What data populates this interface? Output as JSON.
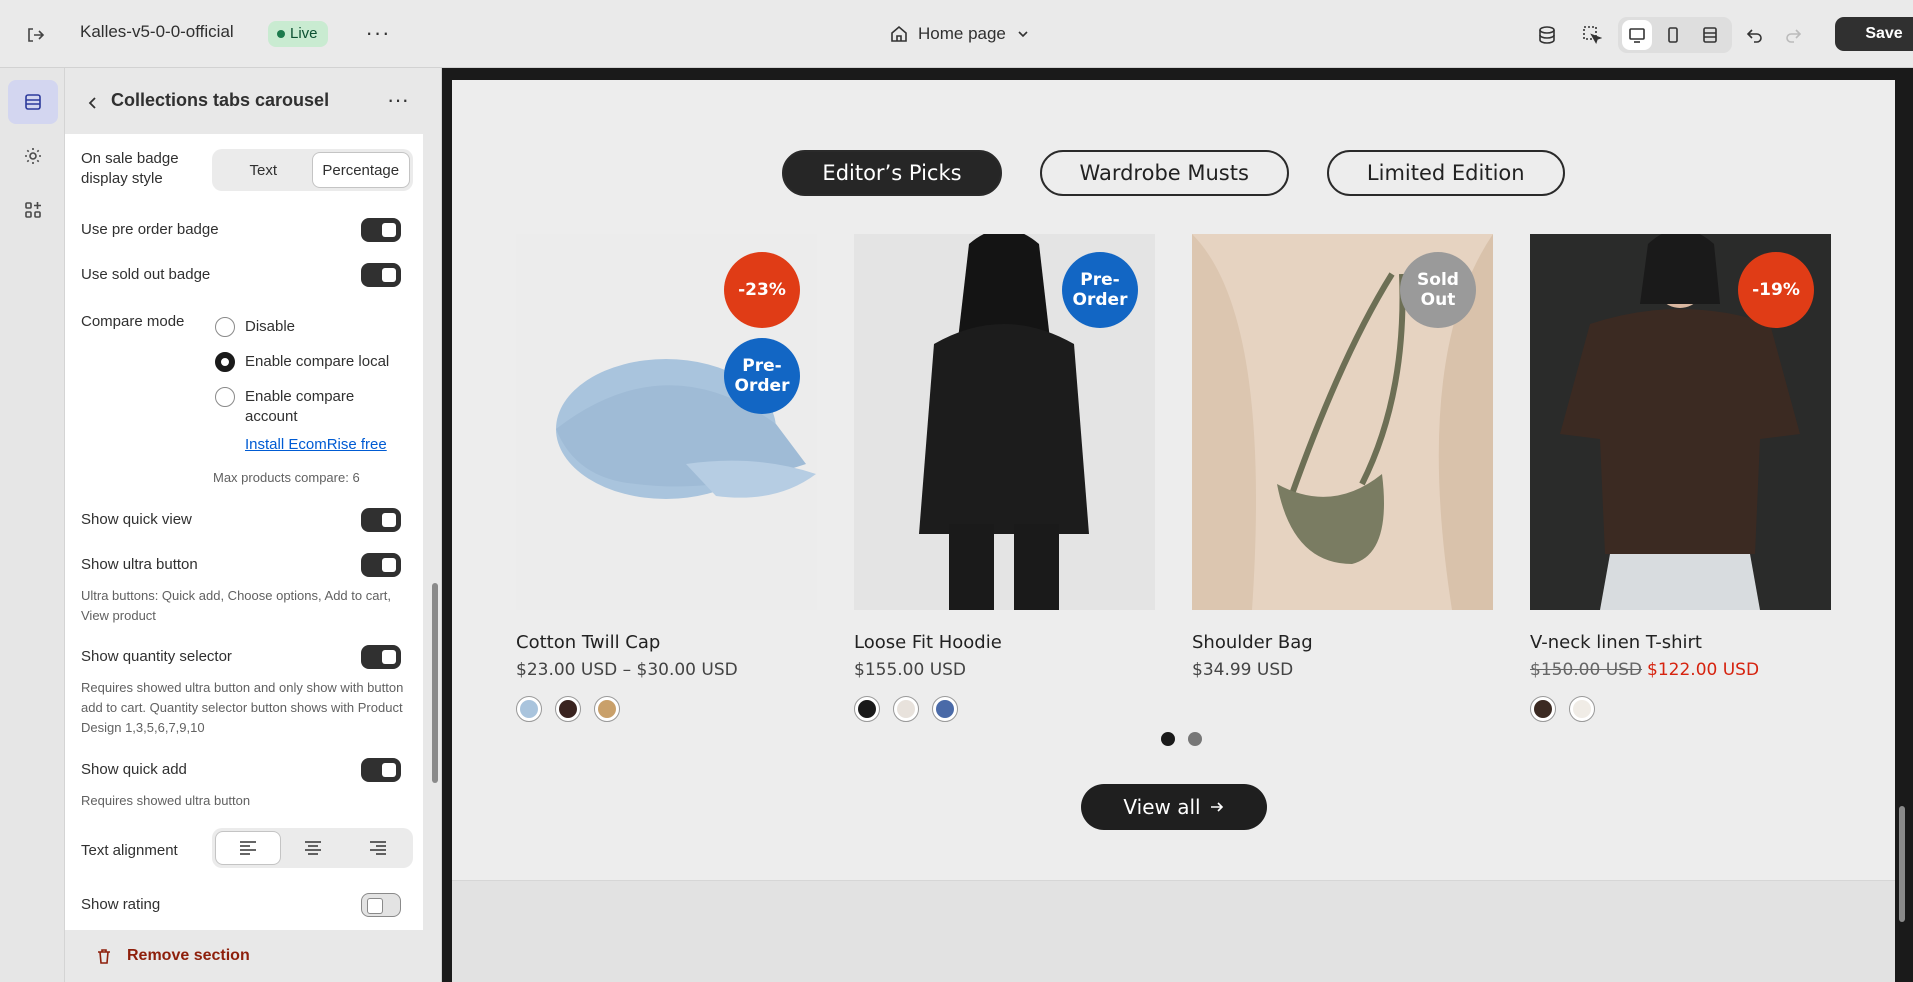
{
  "topbar": {
    "store_name": "Kalles-v5-0-0-official",
    "live_label": "Live",
    "page_selector": "Home page",
    "save_label": "Save"
  },
  "panel": {
    "title": "Collections tabs carousel",
    "settings": {
      "sale_badge_label": "On sale badge display style",
      "sale_badge_options": [
        "Text",
        "Percentage"
      ],
      "sale_badge_selected": "Percentage",
      "pre_order_badge_label": "Use pre order badge",
      "pre_order_badge_on": true,
      "sold_out_badge_label": "Use sold out badge",
      "sold_out_badge_on": true,
      "compare_mode_label": "Compare mode",
      "compare_options": [
        "Disable",
        "Enable compare local",
        "Enable compare account"
      ],
      "compare_selected": "Enable compare local",
      "install_link": "Install EcomRise free",
      "max_compare_help": "Max products compare: 6",
      "quick_view_label": "Show quick view",
      "quick_view_on": true,
      "ultra_button_label": "Show ultra button",
      "ultra_button_on": true,
      "ultra_button_help": "Ultra buttons: Quick add, Choose options, Add to cart, View product",
      "quantity_selector_label": "Show quantity selector",
      "quantity_selector_on": true,
      "quantity_selector_help": "Requires showed ultra button and only show with button add to cart. Quantity selector button shows with Product Design 1,3,5,6,7,9,10",
      "quick_add_label": "Show quick add",
      "quick_add_on": true,
      "quick_add_help": "Requires showed ultra button",
      "text_alignment_label": "Text alignment",
      "text_alignment_selected": "left",
      "show_rating_label": "Show rating",
      "show_rating_on": false
    },
    "remove_section_label": "Remove section"
  },
  "preview": {
    "tabs": [
      "Editor’s Picks",
      "Wardrobe Musts",
      "Limited Edition"
    ],
    "active_tab": "Editor’s Picks",
    "products": [
      {
        "name": "Cotton Twill Cap",
        "price": "$23.00 USD – $30.00 USD",
        "old_price": "",
        "sale_price": "",
        "badges": [
          "-23%",
          "Pre-\nOrder"
        ],
        "swatches": [
          "#a9c4dd",
          "#3a2420",
          "#c9a06a"
        ]
      },
      {
        "name": "Loose Fit Hoodie",
        "price": "$155.00 USD",
        "old_price": "",
        "sale_price": "",
        "badges": [
          "Pre-\nOrder"
        ],
        "swatches": [
          "#1a1a1a",
          "#e8e2dc",
          "#4a6aa8"
        ]
      },
      {
        "name": "Shoulder Bag",
        "price": "$34.99 USD",
        "old_price": "",
        "sale_price": "",
        "badges": [
          "Sold\nOut"
        ],
        "swatches": []
      },
      {
        "name": "V-neck linen T-shirt",
        "price": "",
        "old_price": "$150.00 USD",
        "sale_price": "$122.00 USD",
        "badges": [
          "-19%"
        ],
        "swatches": [
          "#3b2a22",
          "#f0ece6"
        ]
      }
    ],
    "carousel_pages": 2,
    "carousel_active": 1,
    "view_all_label": "View all"
  },
  "colors": {
    "sale_badge": "#e03c16",
    "pre_order_badge": "#1266c4",
    "sold_out_badge": "#9a9a9a",
    "sale_price": "#d6230f",
    "accent_link": "#005bd3"
  }
}
